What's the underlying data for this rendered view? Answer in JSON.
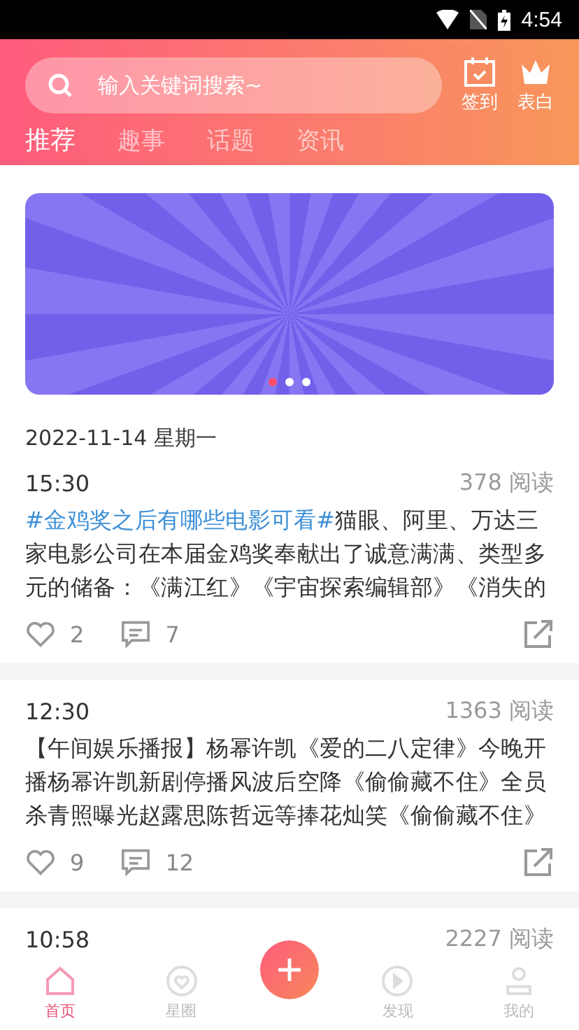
{
  "status_bar": {
    "time": "4:54"
  },
  "header": {
    "search": {
      "placeholder": "输入关键词搜索~"
    },
    "actions": [
      {
        "kind": "checkin",
        "label": "签到"
      },
      {
        "kind": "crown",
        "label": "表白"
      }
    ],
    "tabs": [
      {
        "label": "推荐",
        "selected": true
      },
      {
        "label": "趣事",
        "selected": false
      },
      {
        "label": "话题",
        "selected": false
      },
      {
        "label": "资讯",
        "selected": false
      }
    ]
  },
  "banner": {
    "dots": [
      {
        "selected": true
      },
      {
        "selected": false
      },
      {
        "selected": false
      }
    ]
  },
  "date": "2022-11-14 星期一",
  "posts": [
    {
      "time": "15:30",
      "reads": "378 阅读",
      "tag": "#金鸡奖之后有哪些电影可看#",
      "text": "猫眼、阿里、万达三家电影公司在本届金鸡奖奉献出了诚意满满、类型多元的储备：《满江红》《宇宙探索编辑部》《消失的",
      "likes": "2",
      "comments": "7"
    },
    {
      "time": "12:30",
      "reads": "1363 阅读",
      "text": "【午间娱乐播报】杨幂许凯《爱的二八定律》今晚开播杨幂许凯新剧停播风波后空降《偷偷藏不住》全员杀青照曝光赵露思陈哲远等捧花灿笑《偷偷藏不住》",
      "likes": "9",
      "comments": "12"
    },
    {
      "time": "10:58",
      "reads": "2227 阅读"
    }
  ],
  "nav": [
    {
      "kind": "home",
      "label": "首页",
      "selected": true
    },
    {
      "kind": "heart",
      "label": "星圈",
      "selected": false
    },
    {
      "kind": "add"
    },
    {
      "kind": "play",
      "label": "发现",
      "selected": false
    },
    {
      "kind": "user",
      "label": "我的",
      "selected": false
    }
  ]
}
